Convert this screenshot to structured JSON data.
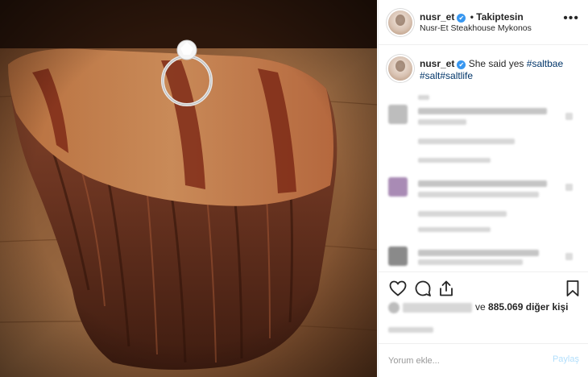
{
  "post": {
    "username": "nusr_et",
    "follow_separator": "•",
    "follow_label": "Takiptesin",
    "location": "Nusr-Et Steakhouse Mykonos",
    "verified_icon": "✔",
    "more_icon": "•••"
  },
  "caption": {
    "username": "nusr_et",
    "text": "She said yes",
    "tags": [
      "#saltbae",
      "#salt",
      "#saltlife"
    ]
  },
  "likes": {
    "connector": "ve",
    "count": "885.069",
    "suffix": "diğer kişi"
  },
  "comment": {
    "placeholder": "Yorum ekle...",
    "post_label": "Paylaş"
  },
  "icons": {
    "like": "heart-icon",
    "comment": "comment-bubble-icon",
    "share": "share-icon",
    "save": "bookmark-icon"
  },
  "colors": {
    "verified": "#3897f0",
    "hashtag": "#003569",
    "post_button": "#b2dffc"
  }
}
